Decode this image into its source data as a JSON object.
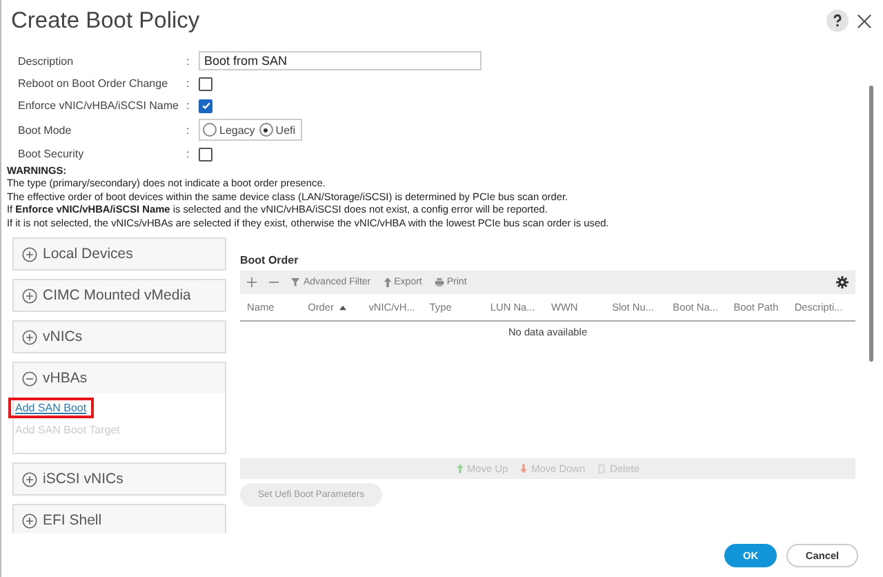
{
  "window": {
    "title": "Create Boot Policy"
  },
  "form": {
    "fields": [
      {
        "kind": "text",
        "label": "Description",
        "separator": ":",
        "value": "Boot from SAN"
      },
      {
        "kind": "checkbox",
        "label": "Reboot on Boot Order Change",
        "separator": ":",
        "checked": false
      },
      {
        "kind": "checkbox",
        "label": "Enforce vNIC/vHBA/iSCSI Name",
        "separator": ":",
        "checked": true
      },
      {
        "kind": "radio",
        "label": "Boot Mode",
        "separator": ":",
        "options": [
          {
            "label": "Legacy",
            "selected": false
          },
          {
            "label": "Uefi",
            "selected": true
          }
        ]
      },
      {
        "kind": "checkbox",
        "label": "Boot Security",
        "separator": ":",
        "checked": false
      }
    ]
  },
  "warnings": {
    "heading": "WARNINGS:",
    "lines": [
      "The type (primary/secondary) does not indicate a boot order presence.",
      "The effective order of boot devices within the same device class (LAN/Storage/iSCSI) is determined by PCIe bus scan order.",
      "If **Enforce vNIC/vHBA/iSCSI Name** is selected and the vNIC/vHBA/iSCSI does not exist, a config error will be reported.",
      "If it is not selected, the vNICs/vHBAs are selected if they exist, otherwise the vNIC/vHBA with the lowest PCIe bus scan order is used."
    ]
  },
  "sections": [
    {
      "label": "Local Devices",
      "expanded": false
    },
    {
      "label": "CIMC Mounted vMedia",
      "expanded": false
    },
    {
      "label": "vNICs",
      "expanded": false
    },
    {
      "label": "vHBAs",
      "expanded": true,
      "links": [
        {
          "label": "Add SAN Boot",
          "disabled": false,
          "highlighted": true
        },
        {
          "label": "Add SAN Boot Target",
          "disabled": true,
          "highlighted": false
        }
      ]
    },
    {
      "label": "iSCSI vNICs",
      "expanded": false
    },
    {
      "label": "EFI Shell",
      "expanded": false
    }
  ],
  "boot_order": {
    "title": "Boot Order",
    "toolbar": [
      {
        "kind": "add"
      },
      {
        "kind": "remove"
      },
      {
        "kind": "filter",
        "label": "Advanced Filter"
      },
      {
        "kind": "export",
        "label": "Export"
      },
      {
        "kind": "print",
        "label": "Print"
      }
    ],
    "columns": [
      {
        "label": "Name",
        "sorted": false
      },
      {
        "label": "Order",
        "sorted": true
      },
      {
        "label": "vNIC/vH...",
        "sorted": false
      },
      {
        "label": "Type",
        "sorted": false
      },
      {
        "label": "LUN Na...",
        "sorted": false
      },
      {
        "label": "WWN",
        "sorted": false
      },
      {
        "label": "Slot Nu...",
        "sorted": false
      },
      {
        "label": "Boot Na...",
        "sorted": false
      },
      {
        "label": "Boot Path",
        "sorted": false
      },
      {
        "label": "Descripti...",
        "sorted": false
      }
    ],
    "empty_text": "No data available",
    "actions": [
      {
        "kind": "up",
        "label": "Move Up",
        "disabled": true
      },
      {
        "kind": "down",
        "label": "Move Down",
        "disabled": true
      },
      {
        "kind": "delete",
        "label": "Delete",
        "disabled": true
      }
    ],
    "uefi_button": {
      "label": "Set Uefi Boot Parameters",
      "disabled": true
    }
  },
  "buttons": [
    {
      "label": "OK",
      "primary": true
    },
    {
      "label": "Cancel",
      "primary": false
    }
  ]
}
